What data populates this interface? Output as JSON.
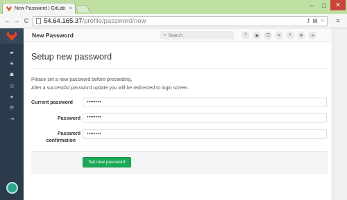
{
  "browser": {
    "tab_title": "New Password | GitLab",
    "tab_close": "×",
    "url_host": "54.64.165.37",
    "url_path": "/profile/password/new",
    "minimize": "–",
    "maximize": "□",
    "close": "✕",
    "back": "←",
    "forward": "→",
    "reload": "C",
    "menu": "≡"
  },
  "header": {
    "title": "New Password",
    "search_placeholder": "Search"
  },
  "page": {
    "heading": "Setup new password",
    "info_line1": "Please set a new password before proceeding.",
    "info_line2": "After a successful password update you will be redirected to login screen."
  },
  "form": {
    "current_password_label": "Current password",
    "current_password_value": "••••••••",
    "password_label": "Password",
    "password_value": "••••••••",
    "confirmation_label_line1": "Password",
    "confirmation_label_line2": "confirmation",
    "confirmation_value": "••••••••",
    "submit_label": "Set new password"
  },
  "colors": {
    "sidebar_bg": "#2b3b4b",
    "submit_bg": "#1aaa55",
    "chrome_green": "#bfe0a2"
  },
  "icons": {
    "sidebar": [
      "dashboard-icon",
      "star-icon",
      "users-icon",
      "clock-icon",
      "info-icon",
      "list-icon",
      "exit-icon"
    ],
    "header": [
      "help-icon",
      "globe-icon",
      "copy-icon",
      "wrench-icon",
      "plus-icon",
      "gear-icon",
      "sign-out-icon"
    ]
  }
}
